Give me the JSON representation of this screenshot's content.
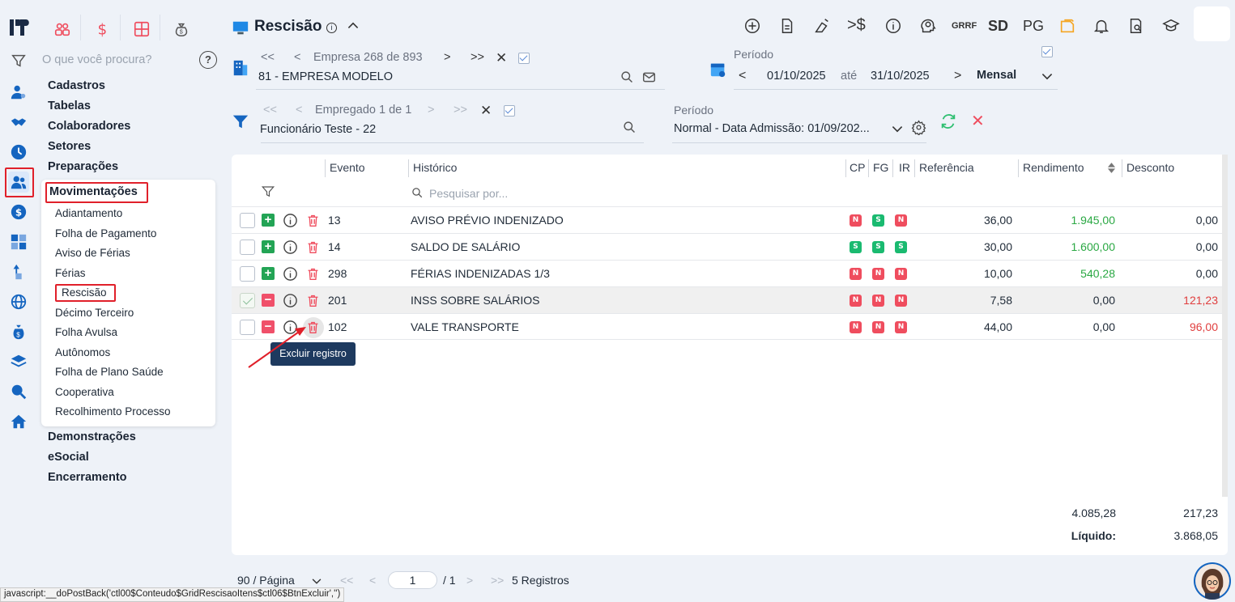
{
  "search": {
    "placeholder": "O que você procura?"
  },
  "menu": {
    "sections_top": [
      "Cadastros",
      "Tabelas",
      "Colaboradores",
      "Setores",
      "Preparações"
    ],
    "active_section": "Movimentações",
    "sub_items": [
      "Adiantamento",
      "Folha de Pagamento",
      "Aviso de Férias",
      "Férias",
      "Rescisão",
      "Décimo Terceiro",
      "Folha Avulsa",
      "Autônomos",
      "Folha de Plano Saúde",
      "Cooperativa",
      "Recolhimento Processo"
    ],
    "sections_bottom": [
      "Demonstrações",
      "eSocial",
      "Encerramento"
    ]
  },
  "header": {
    "title": "Rescisão",
    "toolbar_labels": {
      "grrf": "GRRF",
      "sd": "SD",
      "pg": "PG"
    }
  },
  "empresa": {
    "nav_label": "Empresa 268 de 893",
    "value": "81 - EMPRESA MODELO"
  },
  "periodo": {
    "label": "Período",
    "start": "01/10/2025",
    "until": "até",
    "end": "31/10/2025",
    "type": "Mensal"
  },
  "empregado": {
    "nav_label": "Empregado 1 de 1",
    "value": "Funcionário Teste - 22"
  },
  "periodo2": {
    "label": "Período",
    "value": "Normal - Data Admissão: 01/09/202..."
  },
  "table": {
    "headers": {
      "evento": "Evento",
      "historico": "Histórico",
      "cp": "CP",
      "fg": "FG",
      "ir": "IR",
      "referencia": "Referência",
      "rendimento": "Rendimento",
      "desconto": "Desconto"
    },
    "search_placeholder": "Pesquisar por...",
    "rows": [
      {
        "type": "plus",
        "checked": false,
        "evento": "13",
        "historico": "AVISO PRÉVIO INDENIZADO",
        "cp": "N",
        "fg": "S",
        "ir": "N",
        "referencia": "36,00",
        "rendimento": "1.945,00",
        "desconto": "0,00"
      },
      {
        "type": "plus",
        "checked": false,
        "evento": "14",
        "historico": "SALDO DE SALÁRIO",
        "cp": "S",
        "fg": "S",
        "ir": "S",
        "referencia": "30,00",
        "rendimento": "1.600,00",
        "desconto": "0,00"
      },
      {
        "type": "plus",
        "checked": false,
        "evento": "298",
        "historico": "FÉRIAS INDENIZADAS 1/3",
        "cp": "N",
        "fg": "N",
        "ir": "N",
        "referencia": "10,00",
        "rendimento": "540,28",
        "desconto": "0,00"
      },
      {
        "type": "minus",
        "checked": true,
        "evento": "201",
        "historico": "INSS SOBRE SALÁRIOS",
        "cp": "N",
        "fg": "N",
        "ir": "N",
        "referencia": "7,58",
        "rendimento": "0,00",
        "desconto": "121,23"
      },
      {
        "type": "minus",
        "checked": false,
        "evento": "102",
        "historico": "VALE TRANSPORTE",
        "cp": "N",
        "fg": "N",
        "ir": "N",
        "referencia": "44,00",
        "rendimento": "0,00",
        "desconto": "96,00"
      }
    ],
    "tooltip": "Excluir registro",
    "totals": {
      "rendimento": "4.085,28",
      "desconto": "217,23",
      "liquido_label": "Líquido:",
      "liquido": "3.868,05"
    }
  },
  "pagination": {
    "per_page": "90 / Página",
    "page": "1",
    "of": "/ 1",
    "registros": "5 Registros"
  },
  "status_bar": "javascript:__doPostBack('ctl00$Conteudo$GridRescisaoItens$ctl06$BtnExcluir','')",
  "colors": {
    "accent": "#1565c0",
    "green": "#23a455",
    "red": "#ef4d5e",
    "highlight": "#e0202a"
  }
}
